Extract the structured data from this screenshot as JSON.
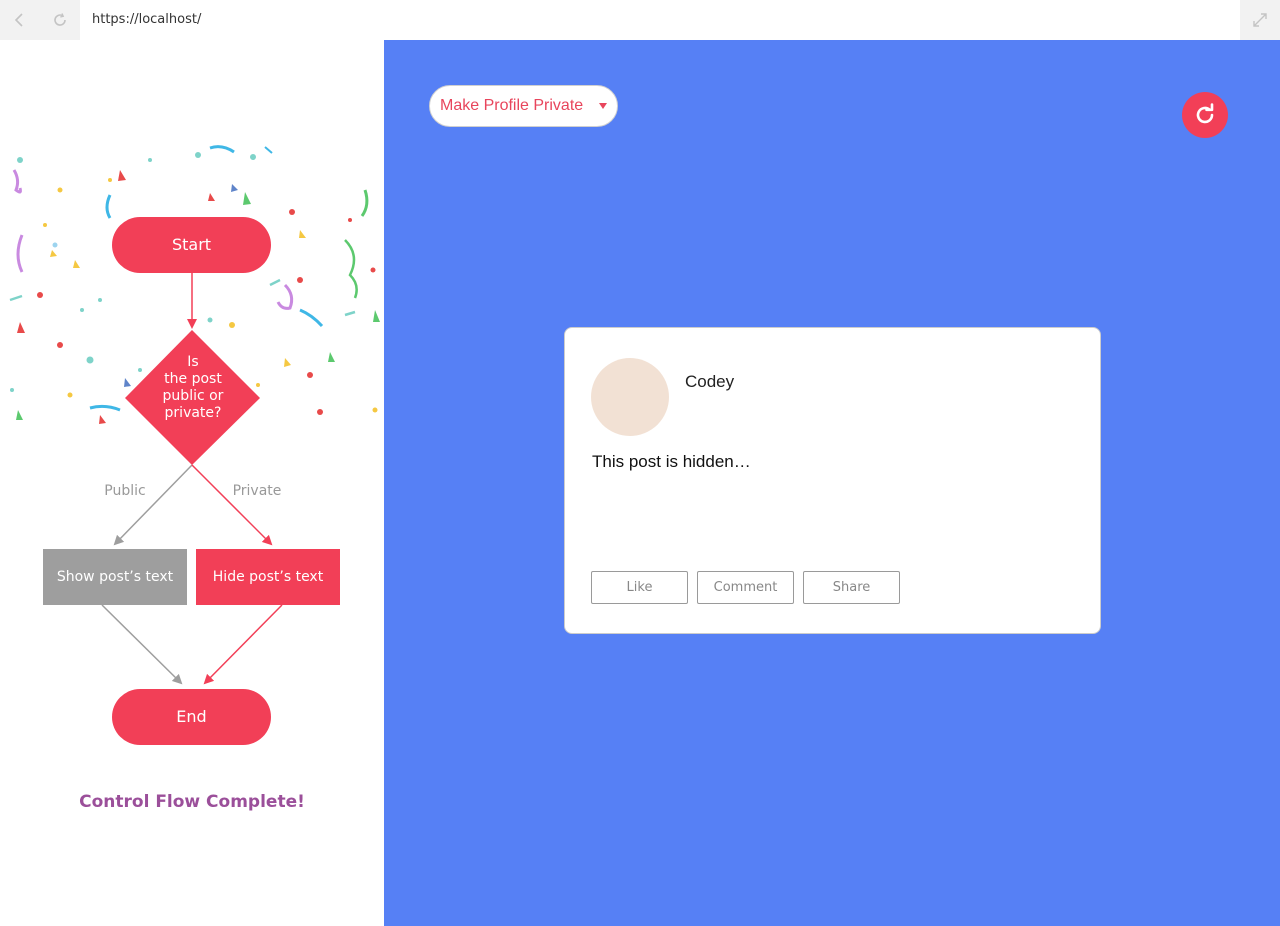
{
  "browser": {
    "url": "https://localhost/",
    "back_icon": "chevron-left-icon",
    "reload_icon": "reload-icon",
    "expand_icon": "expand-diagonal-icon"
  },
  "flowchart": {
    "start_label": "Start",
    "decision_lines": [
      "Is",
      "the post",
      "public or",
      "private?"
    ],
    "branch_public_label": "Public",
    "branch_private_label": "Private",
    "show_label": "Show post’s text",
    "hide_label": "Hide post’s text",
    "end_label": "End",
    "complete_message": "Control Flow Complete!",
    "colors": {
      "accent": "#f23f57",
      "neutral": "#9e9e9e",
      "complete": "#9b4f9a"
    }
  },
  "toolbar": {
    "privacy_select_value": "Make Profile Private",
    "refresh_icon": "refresh-icon"
  },
  "post": {
    "username": "Codey",
    "text": "This post is hidden…",
    "actions": [
      "Like",
      "Comment",
      "Share"
    ]
  },
  "theme": {
    "panel_background": "#5680f5",
    "avatar_color": "#f2e1d4",
    "select_text_color": "#e8455c"
  }
}
